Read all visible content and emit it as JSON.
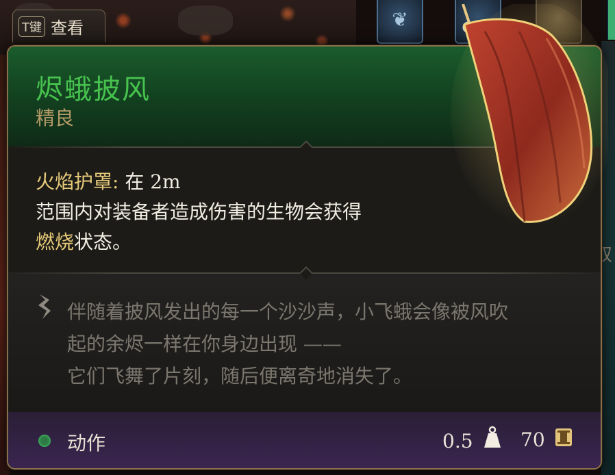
{
  "hud": {
    "view_key": "T键",
    "view_label": "查看",
    "side_glyph": "奴"
  },
  "item": {
    "name": "烬蛾披风",
    "rarity": "精良",
    "name_color": "#47c24e",
    "rarity_color": "#b49a68",
    "effect": {
      "title": "火焰护罩:",
      "range": "在 2m",
      "line2": "范围内对装备者造成伤害的生物会获得",
      "status": "燃烧",
      "status_suffix": "状态。"
    },
    "flavor": {
      "line1": "伴随着披风发出的每一个沙沙声，小飞蛾会像被风吹",
      "line2": "起的余烬一样在你身边出现 ——",
      "line3": "它们飞舞了片刻，随后便离奇地消失了。"
    },
    "footer": {
      "category": "动作",
      "weight": "0.5",
      "price": "70"
    }
  },
  "icons": [
    "scroll-icon",
    "quill-icon",
    "weight-icon",
    "gold-coin-icon",
    "cloak-item-icon"
  ]
}
